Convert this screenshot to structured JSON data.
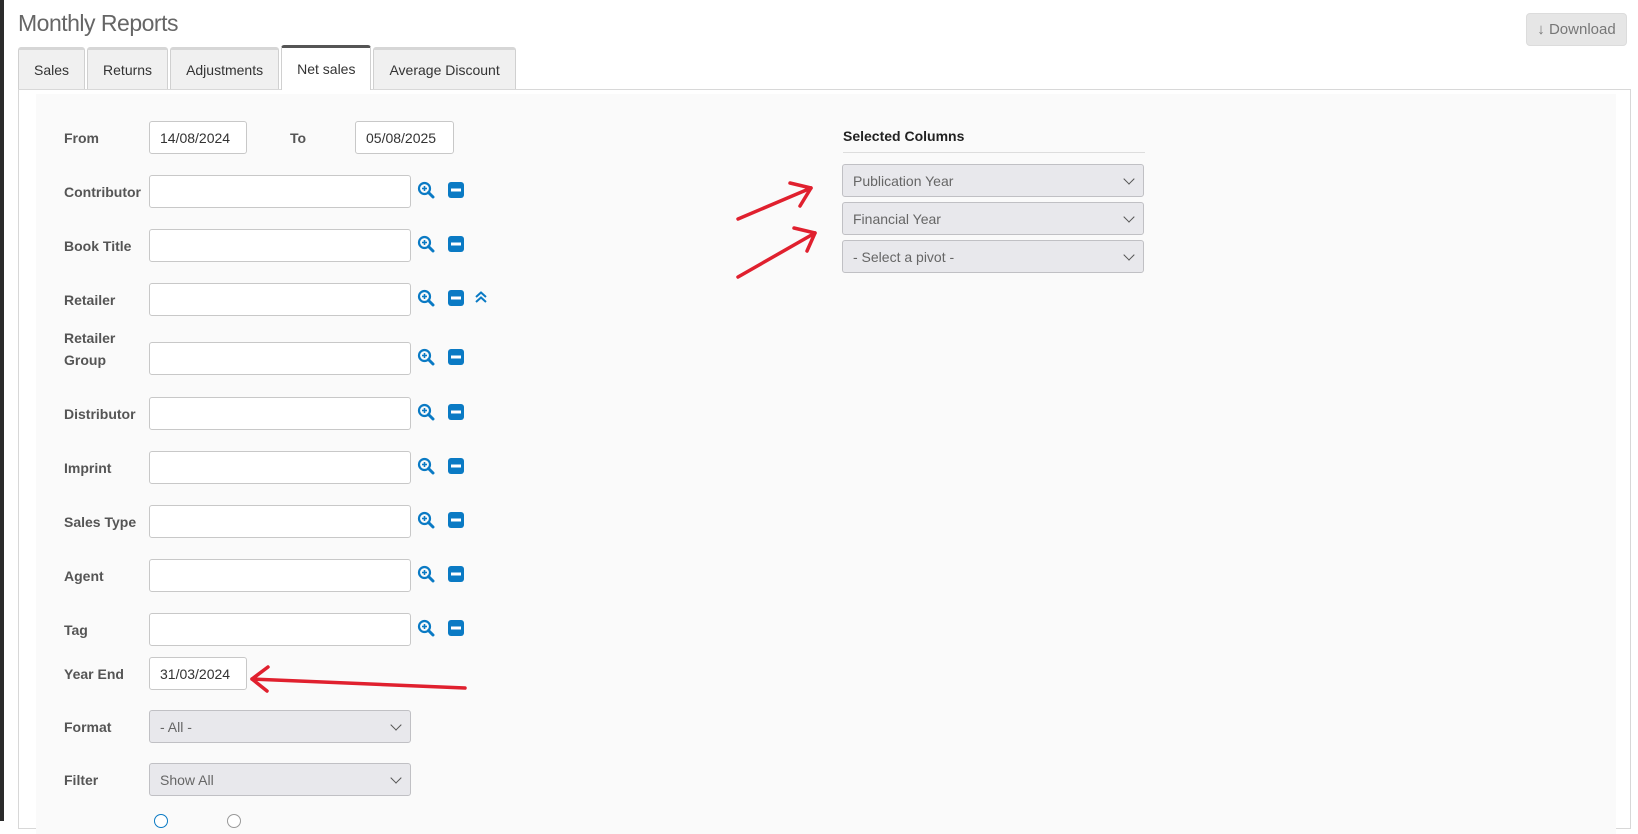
{
  "title": "Monthly Reports",
  "download_label": "↓ Download",
  "tabs": [
    {
      "label": "Sales"
    },
    {
      "label": "Returns"
    },
    {
      "label": "Adjustments"
    },
    {
      "label": "Net sales"
    },
    {
      "label": "Average Discount"
    }
  ],
  "active_tab": "Net sales",
  "date_range": {
    "from_label": "From",
    "from_value": "14/08/2024",
    "to_label": "To",
    "to_value": "05/08/2025"
  },
  "filters": [
    {
      "label": "Contributor"
    },
    {
      "label": "Book Title"
    },
    {
      "label": "Retailer"
    },
    {
      "label": "Retailer Group"
    },
    {
      "label": "Distributor"
    },
    {
      "label": "Imprint"
    },
    {
      "label": "Sales Type"
    },
    {
      "label": "Agent"
    },
    {
      "label": "Tag"
    }
  ],
  "year_end": {
    "label": "Year End",
    "value": "31/03/2024"
  },
  "format": {
    "label": "Format",
    "value": "- All -"
  },
  "filter": {
    "label": "Filter",
    "value": "Show All"
  },
  "selected_columns": {
    "title": "Selected Columns",
    "options": [
      "Publication Year",
      "Financial Year",
      "- Select a pivot -"
    ]
  },
  "colors": {
    "icon_blue": "#0a7ac4",
    "annotation_red": "#e0202e",
    "active_tab_border": "#555555"
  },
  "icons": [
    "search-plus-icon",
    "minus-square-icon",
    "double-chevron-up-icon",
    "chevron-down-icon"
  ]
}
